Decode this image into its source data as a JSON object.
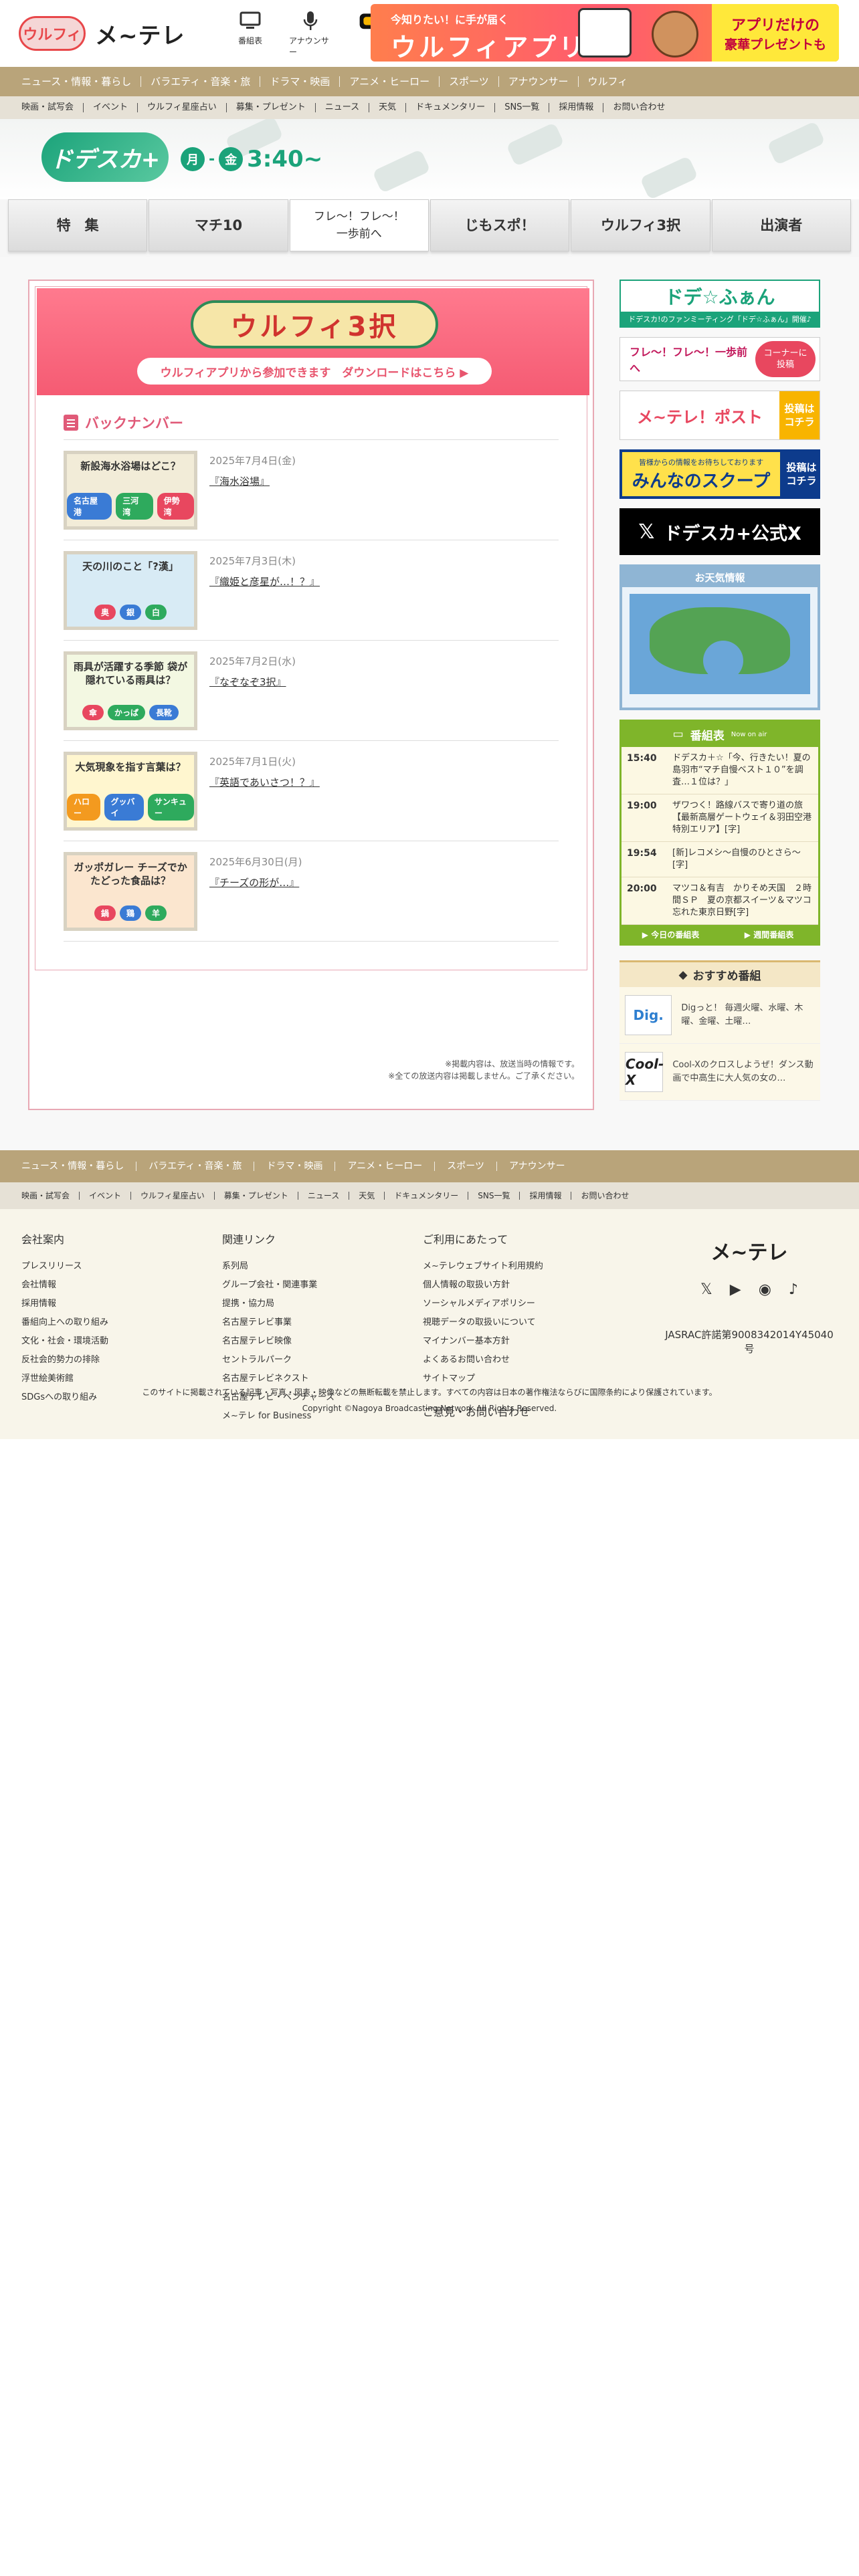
{
  "header": {
    "logo_text": "メ~テレ",
    "mascot_text": "ウルフィ",
    "icons": [
      {
        "label": "番組表",
        "icon": "tv-icon"
      },
      {
        "label": "アナウンサー",
        "icon": "microphone-icon"
      },
      {
        "label": "",
        "icon": "locipo-icon"
      }
    ],
    "banner": {
      "small": "今知りたい！に手が届く",
      "big": "ウルフィアプリ",
      "present_line1": "アプリだけの",
      "present_line2": "豪華プレゼントも"
    }
  },
  "nav_primary": [
    "ニュース・情報・暮らし",
    "バラエティ・音楽・旅",
    "ドラマ・映画",
    "アニメ・ヒーロー",
    "スポーツ",
    "アナウンサー",
    "ウルフィ"
  ],
  "nav_secondary": [
    "映画・試写会",
    "イベント",
    "ウルフィ星座占い",
    "募集・プレゼント",
    "ニュース",
    "天気",
    "ドキュメンタリー",
    "SNS一覧",
    "採用情報",
    "お問い合わせ"
  ],
  "program": {
    "logo": "ドデスカ+",
    "day_from": "月",
    "day_to": "金",
    "time": "3:40~"
  },
  "tabs": [
    {
      "label": "特　集"
    },
    {
      "label": "マチ10"
    },
    {
      "label_line1": "フレ～！フレ～！",
      "label_line2": "一歩前へ"
    },
    {
      "label": "じもスポ！"
    },
    {
      "label": "ウルフィ3択"
    },
    {
      "label": "出演者"
    }
  ],
  "wolf_banner": {
    "title": "ウルフィ3択",
    "cta": "ウルフィアプリから参加できます　ダウンロードはこちら ▶"
  },
  "backnumber": {
    "heading": "バックナンバー",
    "items": [
      {
        "date": "2025年7月4日(金)",
        "title": "『海水浴場』",
        "thumb_text": "新設海水浴場はどこ？",
        "pills": [
          "名古屋港",
          "三河湾",
          "伊勢湾"
        ],
        "colors": [
          "#3a7bd5",
          "#2eaa5d",
          "#e8475f"
        ],
        "bg": "#f2ecd8"
      },
      {
        "date": "2025年7月3日(木)",
        "title": "『織姫と彦星が…！？』",
        "thumb_text": "天の川のこと「?漢」",
        "pills": [
          "奥",
          "銀",
          "白"
        ],
        "colors": [
          "#e8475f",
          "#3a7bd5",
          "#2eaa5d"
        ],
        "bg": "#d8ebf5"
      },
      {
        "date": "2025年7月2日(水)",
        "title": "『なぞなぞ3択』",
        "thumb_text": "雨具が活躍する季節 袋が隠れている雨具は？",
        "pills": [
          "傘",
          "かっぱ",
          "長靴"
        ],
        "colors": [
          "#e8475f",
          "#2eaa5d",
          "#3a7bd5"
        ],
        "bg": "#f3f8e2"
      },
      {
        "date": "2025年7月1日(火)",
        "title": "『英語であいさつ！？』",
        "thumb_text": "大気現象を指す言葉は？",
        "pills": [
          "ハロー",
          "グッバイ",
          "サンキュー"
        ],
        "colors": [
          "#f39a1f",
          "#3a7bd5",
          "#2eaa5d"
        ],
        "bg": "#fff6cf"
      },
      {
        "date": "2025年6月30日(月)",
        "title": "『チーズの形が…』",
        "thumb_text": "ガッポガレー チーズでかたどった食品は？",
        "pills": [
          "鍋",
          "鶏",
          "羊"
        ],
        "colors": [
          "#e8475f",
          "#3a7bd5",
          "#2eaa5d"
        ],
        "bg": "#fbe6cf"
      }
    ],
    "notes": [
      "※掲載内容は、放送当時の情報です。",
      "※全ての放送内容は掲載しません。ご了承ください。"
    ]
  },
  "sidebar": {
    "dodesu_fan": {
      "title": "ドデ☆ふぁん",
      "sub": "ドデスカ!のファンミーティング「ドデ☆ふぁん」開催♪"
    },
    "fure": {
      "title": "フレ～！フレ～！一歩前へ",
      "cta_line1": "コーナーに",
      "cta_line2": "投稿"
    },
    "post": {
      "title": "メ~テレ！ポスト",
      "cta_line1": "投稿は",
      "cta_line2": "コチラ"
    },
    "scoop": {
      "small": "皆様からの情報をお待ちしております",
      "title": "みんなのスクープ",
      "cta_line1": "投稿は",
      "cta_line2": "コチラ"
    },
    "x_account": {
      "icon": "x-logo-icon",
      "title": "ドデスカ+公式X"
    },
    "weather": {
      "heading": "お天気情報"
    },
    "schedule": {
      "heading": "番組表",
      "sub": "Now on air",
      "rows": [
        {
          "time": "15:40",
          "program": "ドデスカ＋☆「今、行きたい！夏の島羽市“マチ自慢ベスト１０”を調査…１位は？」"
        },
        {
          "time": "19:00",
          "program": "ザワつく！路線バスで寄り道の旅【最新高層ゲートウェイ＆羽田空港 特別エリア】[字]"
        },
        {
          "time": "19:54",
          "program": "[新]レコメシ～自慢のひとさら～[字]"
        },
        {
          "time": "20:00",
          "program": "マツコ＆有吉　かりそめ天国　２時間ＳＰ　夏の京都スイーツ＆マツコ忘れた東京日野[字]"
        }
      ],
      "footer_left": "▶ 今日の番組表",
      "footer_right": "▶ 週間番組表"
    },
    "recommend": {
      "heading": "おすすめ番組",
      "items": [
        {
          "thumb": "Dig.",
          "text": "Digっと！ 毎週火曜、水曜、木曜、金曜、土曜…"
        },
        {
          "thumb": "Cool-X",
          "text": "Cool-Xのクロスしようぜ！ダンス動画で中高生に大人気の女の…"
        }
      ]
    }
  },
  "footer": {
    "nav_primary": [
      "ニュース・情報・暮らし",
      "バラエティ・音楽・旅",
      "ドラマ・映画",
      "アニメ・ヒーロー",
      "スポーツ",
      "アナウンサー"
    ],
    "nav_secondary": [
      "映画・試写会",
      "イベント",
      "ウルフィ星座占い",
      "募集・プレゼント",
      "ニュース",
      "天気",
      "ドキュメンタリー",
      "SNS一覧",
      "採用情報",
      "お問い合わせ"
    ],
    "col1": {
      "heading": "会社案内",
      "links": [
        "プレスリリース",
        "会社情報",
        "採用情報",
        "番組向上への取り組み",
        "文化・社会・環境活動",
        "反社会的勢力の排除",
        "浮世絵美術館",
        "SDGsへの取り組み"
      ]
    },
    "col2": {
      "heading": "関連リンク",
      "links": [
        "系列局",
        "グループ会社・関連事業",
        "提携・協力局",
        "名古屋テレビ事業",
        "名古屋テレビ映像",
        "セントラルパーク",
        "名古屋テレビネクスト",
        "名古屋テレビ・ベンチャーズ",
        "メ~テレ for Business"
      ]
    },
    "col3": {
      "heading": "ご利用にあたって",
      "links": [
        "メ~テレウェブサイト利用規約",
        "個人情報の取扱い方針",
        "ソーシャルメディアポリシー",
        "視聴データの取扱いについて",
        "マイナンバー基本方針",
        "よくあるお問い合わせ",
        "サイトマップ"
      ],
      "extra": "ご意見・お問い合わせ"
    },
    "brand": "メ~テレ",
    "sns_icons": [
      "x-icon",
      "youtube-icon",
      "line-icon",
      "tiktok-icon"
    ],
    "jasrac": "JASRAC許諾第9008342014Y45040号",
    "copy1": "このサイトに掲載されている記事・写真・図表・映像などの無断転載を禁止します。すべての内容は日本の著作権法ならびに国際条約により保護されています。",
    "copy2": "Copyright ©Nagoya Broadcasting Network All Rights Reserved."
  }
}
